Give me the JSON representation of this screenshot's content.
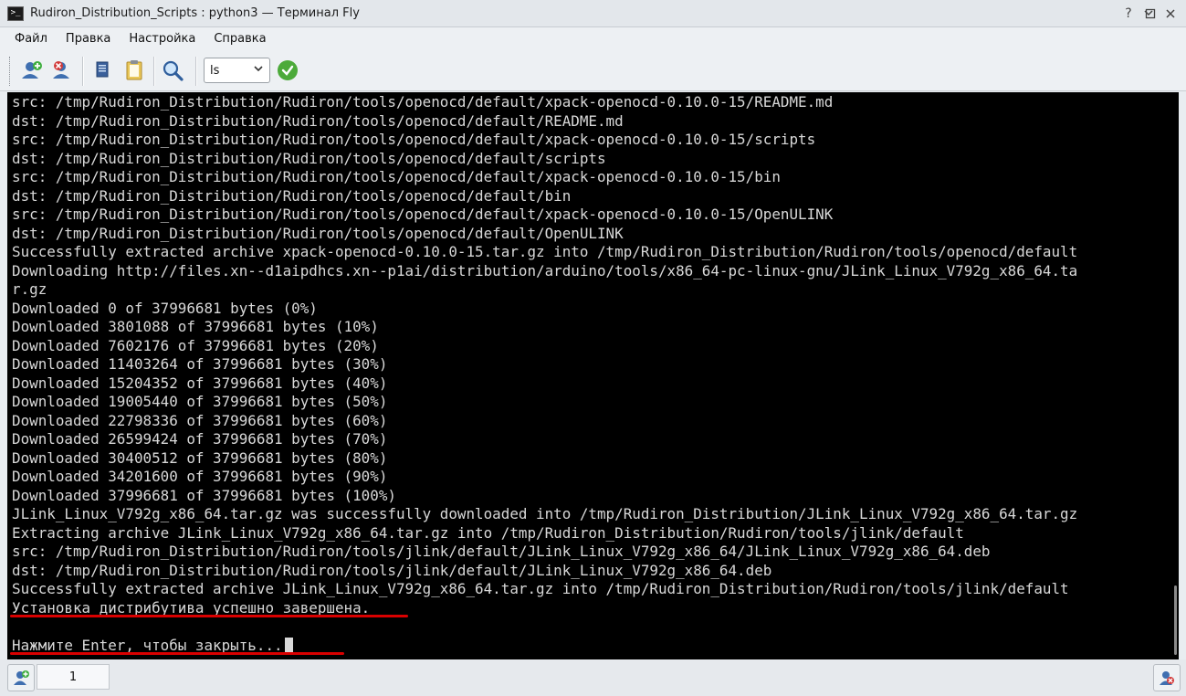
{
  "window": {
    "title": "Rudiron_Distribution_Scripts : python3 — Терминал Fly",
    "app_icon_glyph": ">_"
  },
  "menu": [
    "Файл",
    "Правка",
    "Настройка",
    "Справка"
  ],
  "toolbar": {
    "command_combo_value": "ls",
    "icons": [
      "new-session-icon",
      "close-session-icon",
      "copy-icon",
      "paste-icon",
      "find-icon",
      "confirm-icon"
    ]
  },
  "terminal": {
    "lines": [
      "src: /tmp/Rudiron_Distribution/Rudiron/tools/openocd/default/xpack-openocd-0.10.0-15/README.md",
      "dst: /tmp/Rudiron_Distribution/Rudiron/tools/openocd/default/README.md",
      "src: /tmp/Rudiron_Distribution/Rudiron/tools/openocd/default/xpack-openocd-0.10.0-15/scripts",
      "dst: /tmp/Rudiron_Distribution/Rudiron/tools/openocd/default/scripts",
      "src: /tmp/Rudiron_Distribution/Rudiron/tools/openocd/default/xpack-openocd-0.10.0-15/bin",
      "dst: /tmp/Rudiron_Distribution/Rudiron/tools/openocd/default/bin",
      "src: /tmp/Rudiron_Distribution/Rudiron/tools/openocd/default/xpack-openocd-0.10.0-15/OpenULINK",
      "dst: /tmp/Rudiron_Distribution/Rudiron/tools/openocd/default/OpenULINK",
      "Successfully extracted archive xpack-openocd-0.10.0-15.tar.gz into /tmp/Rudiron_Distribution/Rudiron/tools/openocd/default",
      "Downloading http://files.xn--d1aipdhcs.xn--p1ai/distribution/arduino/tools/x86_64-pc-linux-gnu/JLink_Linux_V792g_x86_64.ta",
      "r.gz",
      "Downloaded 0 of 37996681 bytes (0%)",
      "Downloaded 3801088 of 37996681 bytes (10%)",
      "Downloaded 7602176 of 37996681 bytes (20%)",
      "Downloaded 11403264 of 37996681 bytes (30%)",
      "Downloaded 15204352 of 37996681 bytes (40%)",
      "Downloaded 19005440 of 37996681 bytes (50%)",
      "Downloaded 22798336 of 37996681 bytes (60%)",
      "Downloaded 26599424 of 37996681 bytes (70%)",
      "Downloaded 30400512 of 37996681 bytes (80%)",
      "Downloaded 34201600 of 37996681 bytes (90%)",
      "Downloaded 37996681 of 37996681 bytes (100%)",
      "JLink_Linux_V792g_x86_64.tar.gz was successfully downloaded into /tmp/Rudiron_Distribution/JLink_Linux_V792g_x86_64.tar.gz",
      "Extracting archive JLink_Linux_V792g_x86_64.tar.gz into /tmp/Rudiron_Distribution/Rudiron/tools/jlink/default",
      "src: /tmp/Rudiron_Distribution/Rudiron/tools/jlink/default/JLink_Linux_V792g_x86_64/JLink_Linux_V792g_x86_64.deb",
      "dst: /tmp/Rudiron_Distribution/Rudiron/tools/jlink/default/JLink_Linux_V792g_x86_64.deb",
      "Successfully extracted archive JLink_Linux_V792g_x86_64.tar.gz into /tmp/Rudiron_Distribution/Rudiron/tools/jlink/default",
      "Установка дистрибутива успешно завершена.",
      "",
      "Нажмите Enter, чтобы закрыть..."
    ],
    "colors": {
      "background": "#000000",
      "foreground": "#d8d8d8",
      "annotation": "#d90000"
    }
  },
  "statusbar": {
    "tab_label": "1"
  }
}
